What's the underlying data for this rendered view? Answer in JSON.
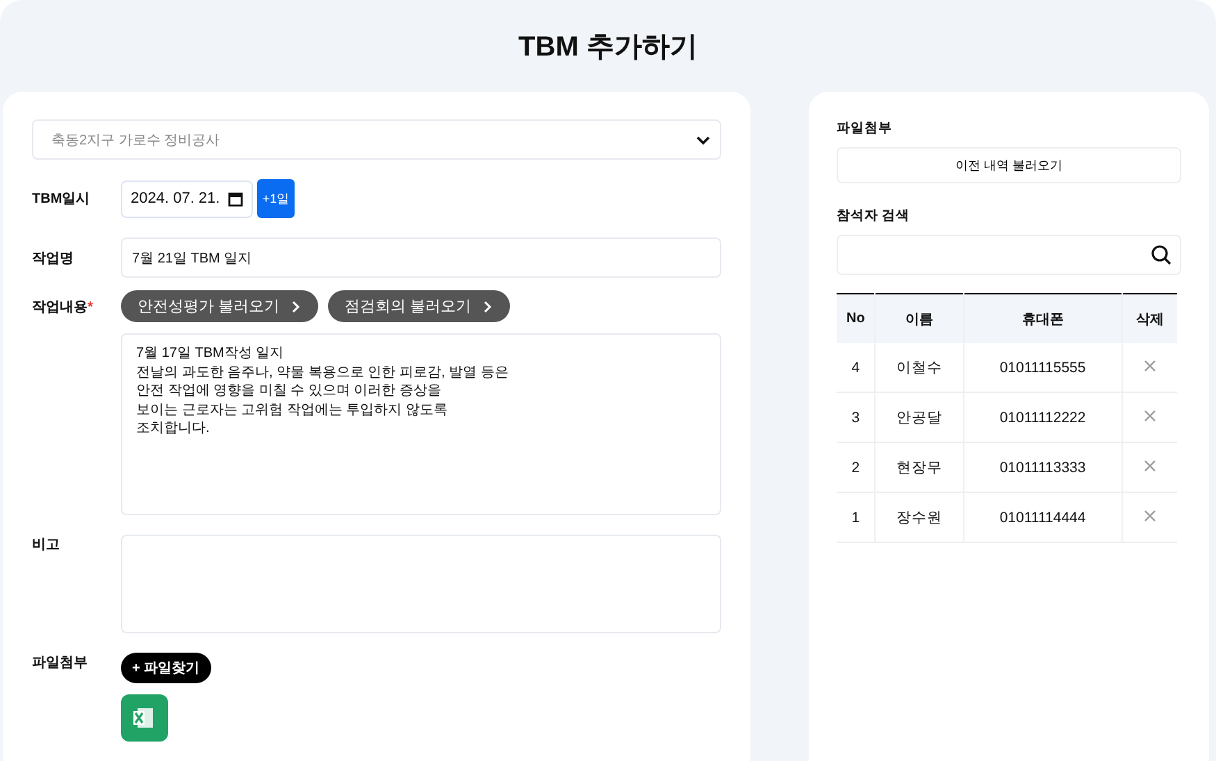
{
  "title": "TBM 추가하기",
  "form": {
    "site_select": {
      "value": "축동2지구 가로수 정비공사"
    },
    "date": {
      "label": "TBM일시",
      "value": "2024. 07. 21.",
      "plus_button": "+1일"
    },
    "work_name": {
      "label": "작업명",
      "value": "7월 21일 TBM 일지"
    },
    "work_content": {
      "label": "작업내용",
      "required_mark": "*",
      "load_buttons": [
        "안전성평가 불러오기",
        "점검회의 불러오기"
      ],
      "value": "7월 17일 TBM작성 일지\n전날의 과도한 음주나, 약물 복용으로 인한 피로감, 발열 등은\n안전 작업에 영향을 미칠 수 있으며 이러한 증상을\n보이는 근로자는 고위험 작업에는 투입하지 않도록\n조치합니다."
    },
    "note": {
      "label": "비고"
    },
    "attachment": {
      "label": "파일첨부",
      "button": "+ 파일찾기"
    }
  },
  "side": {
    "attachment_label": "파일첨부",
    "history_button": "이전 내역 불러오기",
    "search_label": "참석자 검색",
    "table": {
      "columns": [
        "No",
        "이름",
        "휴대폰",
        "삭제"
      ],
      "rows": [
        {
          "no": "4",
          "name": "이철수",
          "phone": "01011115555"
        },
        {
          "no": "3",
          "name": "안공달",
          "phone": "01011112222"
        },
        {
          "no": "2",
          "name": "현장무",
          "phone": "01011113333"
        },
        {
          "no": "1",
          "name": "장수원",
          "phone": "01011114444"
        }
      ]
    }
  }
}
